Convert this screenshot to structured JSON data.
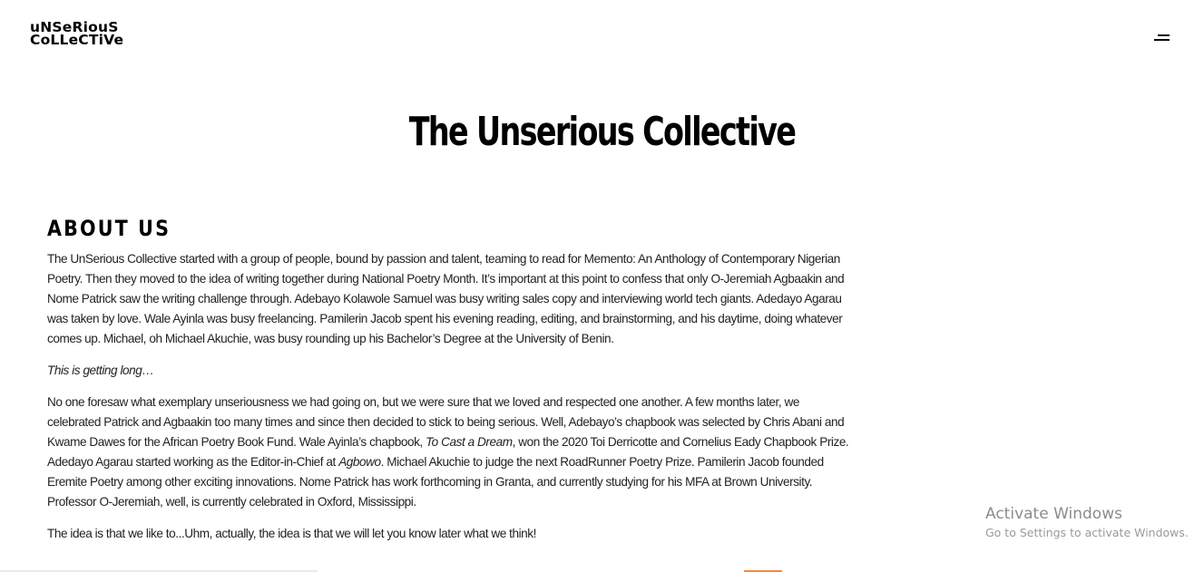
{
  "header": {
    "logo_line1": "uNSeRiouS",
    "logo_line2": "CoLLeCTiVe",
    "menu_icon": "hamburger-menu-icon"
  },
  "main": {
    "title": "The Unserious Collective",
    "about": {
      "heading": "ABOUT US",
      "p1": "The UnSerious Collective started with a group of people, bound by passion and talent, teaming to read for Memento: An Anthology of Contemporary Nigerian Poetry. Then they moved to the idea of writing together during National Poetry Month. It’s important at this point to confess that only O-Jeremiah Agbaakin and Nome Patrick saw the writing challenge through. Adebayo Kolawole Samuel was busy writing sales copy and interviewing world tech giants. Adedayo Agarau was taken by love. Wale Ayinla was busy freelancing. Pamilerin Jacob spent his evening reading, editing, and brainstorming, and his daytime, doing whatever comes up. Michael, oh Michael Akuchie, was busy rounding up his Bachelor’s Degree at the University of Benin.",
      "p2": "This is getting long…",
      "p3_a": "No one foresaw what exemplary unseriousness we had going on, but we were sure that we loved and respected one another. A few months later, we celebrated Patrick and Agbaakin too many times and since then decided to stick to being serious. Well, Adebayo’s chapbook was selected by Chris Abani and Kwame Dawes for the African Poetry Book Fund. Wale Ayinla’s chapbook, ",
      "p3_book": "To Cast a Dream",
      "p3_b": ", won the 2020 Toi Derricotte and Cornelius Eady Chapbook Prize. Adedayo Agarau started working as the Editor-in-Chief at ",
      "p3_mag": "Agbowo",
      "p3_c": ". Michael Akuchie to judge the next RoadRunner Poetry Prize. Pamilerin Jacob founded Eremite Poetry among other exciting innovations. Nome Patrick has work forthcoming in Granta, and currently studying for his MFA at Brown University. Professor O-Jeremiah, well, is currently celebrated in Oxford, Mississippi.",
      "p4": "The idea is that we like to...Uhm, actually, the idea is that we will let you know later what we think!"
    }
  },
  "watermark": {
    "title": "Activate Windows",
    "subtitle": "Go to Settings to activate Windows."
  },
  "colors": {
    "background": "#ffffff",
    "text": "#222222",
    "heading": "#000000",
    "watermark": "#8c8c8c",
    "accent_strip": "#f08a4b"
  }
}
